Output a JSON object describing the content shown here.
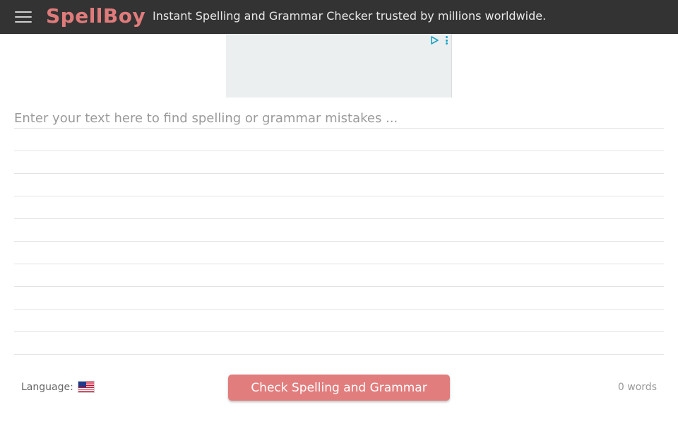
{
  "header": {
    "logo": "SpellBoy",
    "tagline": "Instant Spelling and Grammar Checker trusted by millions worldwide."
  },
  "editor": {
    "placeholder": "Enter your text here to find spelling or grammar mistakes ...",
    "value": ""
  },
  "footer": {
    "language_label": "Language:",
    "check_button": "Check Spelling and Grammar",
    "word_count": "0 words"
  },
  "icons": {
    "menu": "hamburger-icon",
    "flag": "us-flag-icon",
    "ad_choices": "ad-choices-icon",
    "ad_more": "vertical-dots-icon"
  },
  "colors": {
    "header_bg": "#333333",
    "brand": "#e07b7b",
    "button_bg": "#e27d7d",
    "ad_accent": "#1aa3c4"
  }
}
